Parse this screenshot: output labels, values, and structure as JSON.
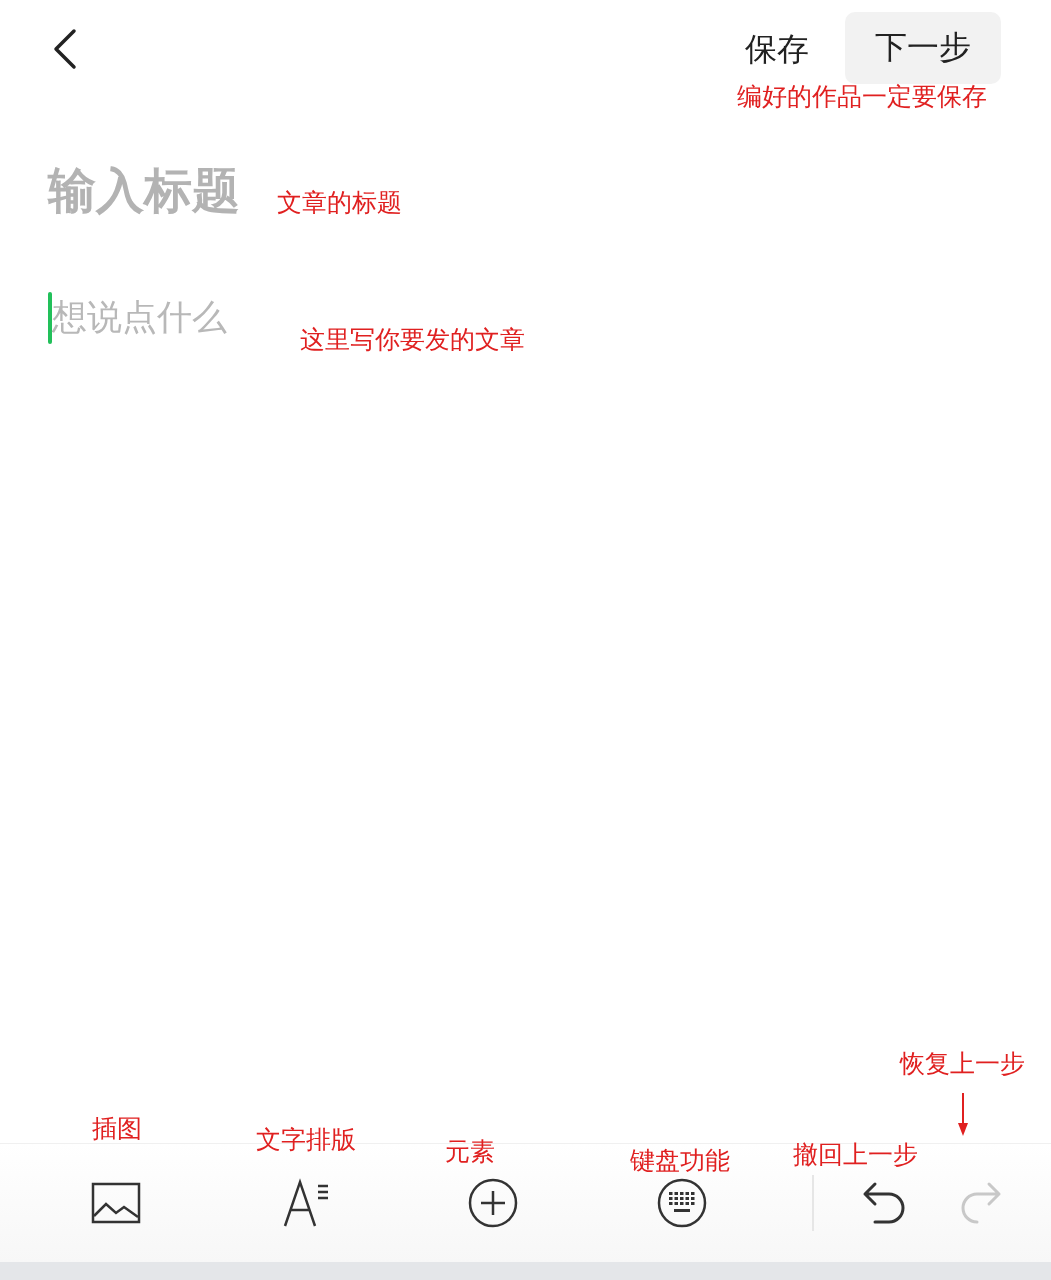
{
  "header": {
    "save": "保存",
    "next": "下一步"
  },
  "title_field": {
    "placeholder": "输入标题"
  },
  "body_field": {
    "placeholder": "想说点什么",
    "focused": true
  },
  "toolbar": [
    {
      "kind": "image",
      "disabled": false
    },
    {
      "kind": "text-format",
      "disabled": false
    },
    {
      "kind": "add",
      "disabled": false
    },
    {
      "kind": "keyboard",
      "disabled": false
    },
    {
      "kind": "undo",
      "disabled": false
    },
    {
      "kind": "redo",
      "disabled": true
    }
  ],
  "annotations": [
    {
      "text": "编好的作品一定要保存"
    },
    {
      "text": "文章的标题"
    },
    {
      "text": "这里写你要发的文章"
    },
    {
      "text": "恢复上一步"
    },
    {
      "text": "插图"
    },
    {
      "text": "文字排版"
    },
    {
      "text": "元素"
    },
    {
      "text": "键盘功能"
    },
    {
      "text": "撤回上一步"
    }
  ]
}
